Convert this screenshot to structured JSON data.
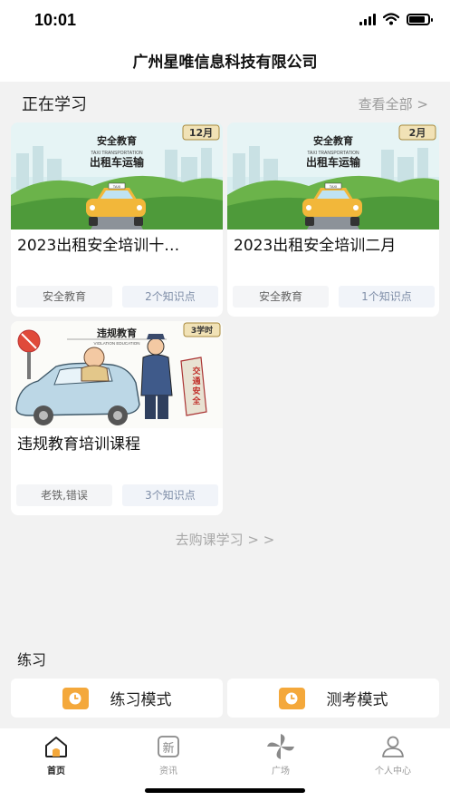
{
  "status_bar": {
    "time": "10:01",
    "battery_level": 0.85
  },
  "header": {
    "title": "广州星唯信息科技有限公司"
  },
  "learning": {
    "section_title": "正在学习",
    "see_all": "查看全部 >",
    "courses": [
      {
        "title": "2023出租安全培训十…",
        "category": "安全教育",
        "knowledge_points": "2个知识点",
        "thumb": {
          "header": "安全教育",
          "sub": "TAXI TRANSPORTATION",
          "main": "出租车运输",
          "badge": "12月",
          "taxi_sign": "TAXI"
        }
      },
      {
        "title": "2023出租安全培训二月",
        "category": "安全教育",
        "knowledge_points": "1个知识点",
        "thumb": {
          "header": "安全教育",
          "sub": "TAXI TRANSPORTATION",
          "main": "出租车运输",
          "badge": "2月",
          "taxi_sign": "TAXI"
        }
      },
      {
        "title": "违规教育培训课程",
        "category": "老铁,错误",
        "knowledge_points": "3个知识点",
        "thumb": {
          "header": "违规教育",
          "sub": "VIOLATION EDUCATION",
          "badge": "3学时",
          "sign": [
            "交",
            "通",
            "安",
            "全"
          ]
        }
      }
    ],
    "buy_link": "去购课学习 > >"
  },
  "practice": {
    "section_title": "练习",
    "modes": [
      {
        "label": "练习模式",
        "icon": "clock-icon"
      },
      {
        "label": "测考模式",
        "icon": "clock-icon"
      }
    ]
  },
  "tabbar": {
    "tabs": [
      {
        "label": "首页",
        "icon": "home-icon",
        "active": true
      },
      {
        "label": "资讯",
        "icon": "news-icon",
        "active": false,
        "glyph": "新"
      },
      {
        "label": "广场",
        "icon": "pinwheel-icon",
        "active": false
      },
      {
        "label": "个人中心",
        "icon": "user-icon",
        "active": false
      }
    ]
  },
  "colors": {
    "accent": "#f4a83b",
    "tag_blue_text": "#7f8ea8",
    "muted": "#9a9a9a"
  }
}
